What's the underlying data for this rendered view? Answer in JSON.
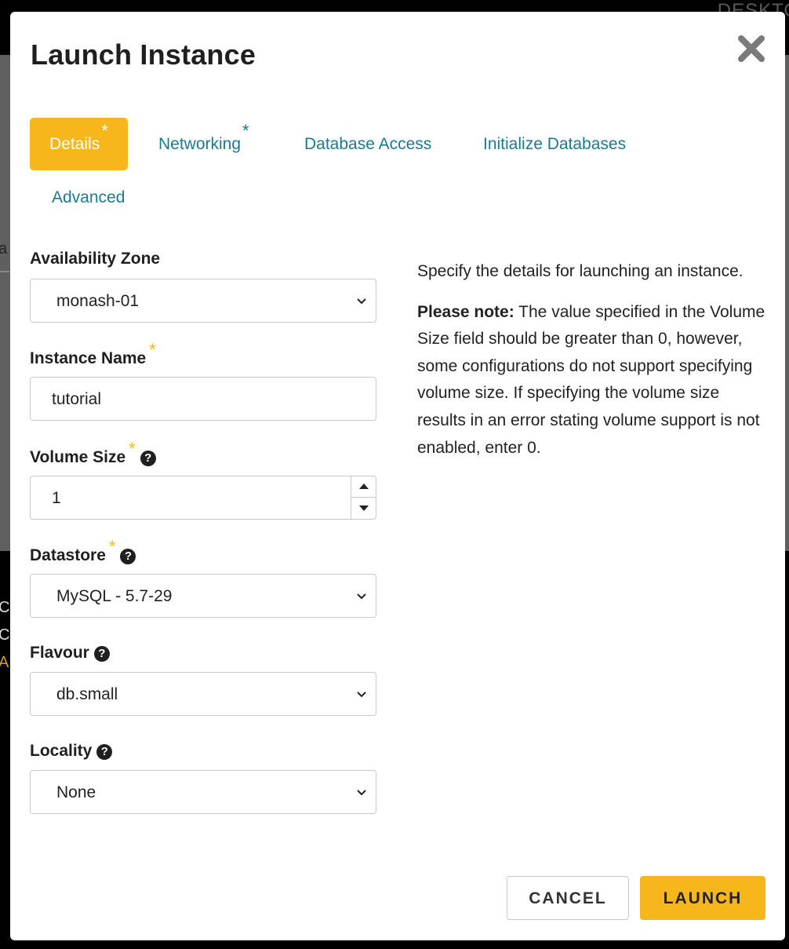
{
  "background": {
    "desktop_text": "DESKTOP",
    "side_letters": [
      "a",
      "C",
      "C)",
      "A"
    ]
  },
  "modal": {
    "title": "Launch Instance",
    "close_icon": "close-icon"
  },
  "tabs": [
    {
      "label": "Details",
      "required": "*",
      "active": true
    },
    {
      "label": "Networking",
      "required": "*",
      "active": false
    },
    {
      "label": "Database Access",
      "required": "",
      "active": false
    },
    {
      "label": "Initialize Databases",
      "required": "",
      "active": false
    },
    {
      "label": "Advanced",
      "required": "",
      "active": false
    }
  ],
  "form": {
    "availability_zone": {
      "label": "Availability Zone",
      "value": "monash-01"
    },
    "instance_name": {
      "label": "Instance Name",
      "required": "*",
      "value": "tutorial"
    },
    "volume_size": {
      "label": "Volume Size",
      "required": "*",
      "help": "?",
      "value": "1"
    },
    "datastore": {
      "label": "Datastore",
      "required": "*",
      "help": "?",
      "value": "MySQL - 5.7-29"
    },
    "flavour": {
      "label": "Flavour",
      "help": "?",
      "value": "db.small"
    },
    "locality": {
      "label": "Locality",
      "help": "?",
      "value": "None"
    }
  },
  "info": {
    "intro": "Specify the details for launching an instance.",
    "note_label": "Please note:",
    "note_text": " The value specified in the Volume Size field should be greater than 0, however, some configurations do not support specifying volume size. If specifying the volume size results in an error stating volume support is not enabled, enter 0."
  },
  "footer": {
    "cancel_label": "CANCEL",
    "launch_label": "LAUNCH"
  },
  "colors": {
    "accent": "#f7b71c",
    "link": "#1a7b8f"
  }
}
